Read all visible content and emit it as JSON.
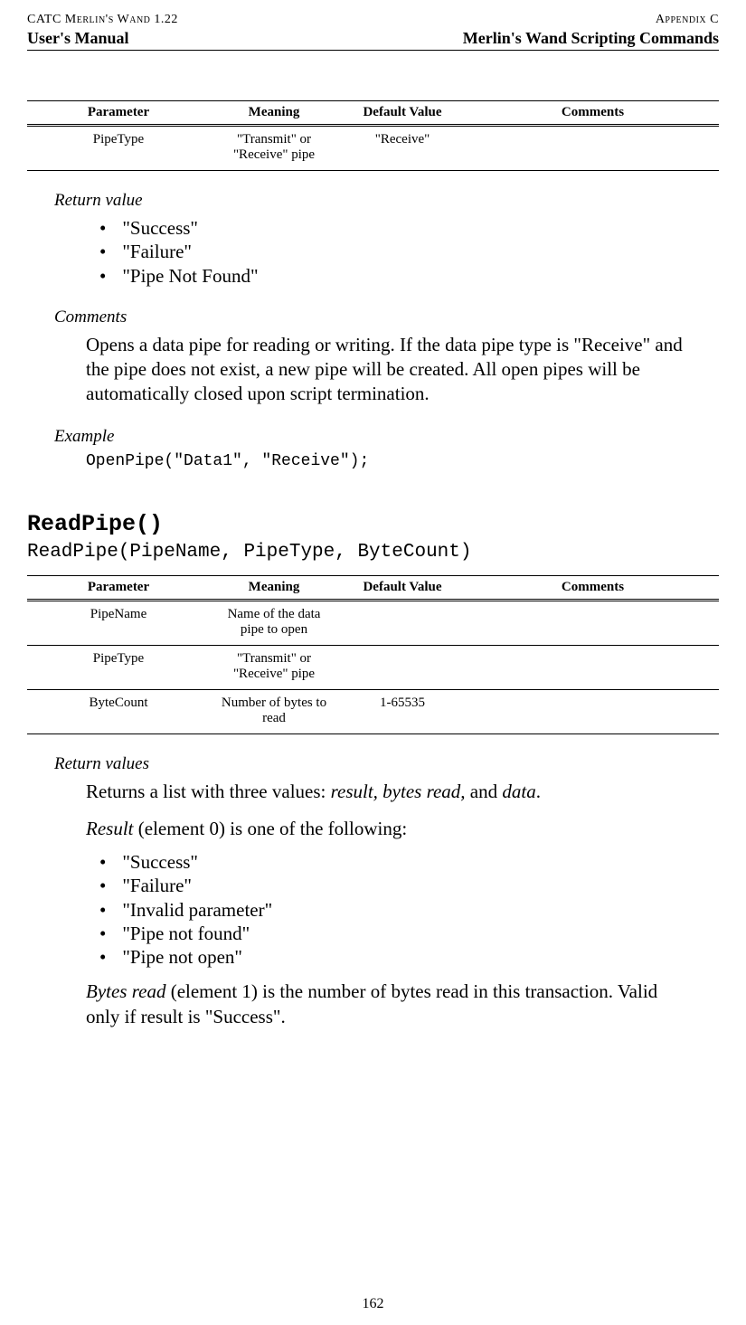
{
  "header": {
    "left_top": "CATC Merlin's Wand 1.22",
    "right_top": "Appendix C",
    "left_bot": "User's Manual",
    "right_bot": "Merlin's Wand Scripting Commands"
  },
  "table1": {
    "headers": {
      "p": "Parameter",
      "m": "Meaning",
      "d": "Default Value",
      "c": "Comments"
    },
    "rows": [
      {
        "p": "PipeType",
        "m": "\"Transmit\" or \"Receive\" pipe",
        "d": "\"Receive\"",
        "c": ""
      }
    ]
  },
  "sec1": {
    "return_value_h": "Return value",
    "bullets": [
      "\"Success\"",
      "\"Failure\"",
      "\"Pipe Not Found\""
    ],
    "comments_h": "Comments",
    "comments_body": "Opens a data pipe for reading or writing. If the data pipe type is \"Receive\" and the pipe does not exist, a new pipe will be created. All open pipes will be automatically closed upon script termination.",
    "example_h": "Example",
    "example_code": "OpenPipe(\"Data1\", \"Receive\");"
  },
  "func2": {
    "name": "ReadPipe()",
    "sig": "ReadPipe(PipeName, PipeType, ByteCount)"
  },
  "table2": {
    "headers": {
      "p": "Parameter",
      "m": "Meaning",
      "d": "Default Value",
      "c": "Comments"
    },
    "rows": [
      {
        "p": "PipeName",
        "m": "Name of the data pipe to open",
        "d": "",
        "c": ""
      },
      {
        "p": "PipeType",
        "m": "\"Transmit\" or \"Receive\" pipe",
        "d": "",
        "c": ""
      },
      {
        "p": "ByteCount",
        "m": "Number of bytes to read",
        "d": "1-65535",
        "c": ""
      }
    ]
  },
  "sec2": {
    "return_values_h": "Return values",
    "intro_pre": "Returns a list with three values: ",
    "intro_italic": "result, bytes read,",
    "intro_mid": " and ",
    "intro_italic2": "data",
    "intro_post": ".",
    "result_italic": "Result",
    "result_rest": " (element 0) is one of the following:",
    "bullets": [
      "\"Success\"",
      "\"Failure\"",
      "\"Invalid parameter\"",
      "\"Pipe not found\"",
      "\"Pipe not open\""
    ],
    "bytes_italic": "Bytes read",
    "bytes_rest": " (element 1) is the number of bytes read in this transaction. Valid only if result is \"Success\"."
  },
  "page_number": "162"
}
